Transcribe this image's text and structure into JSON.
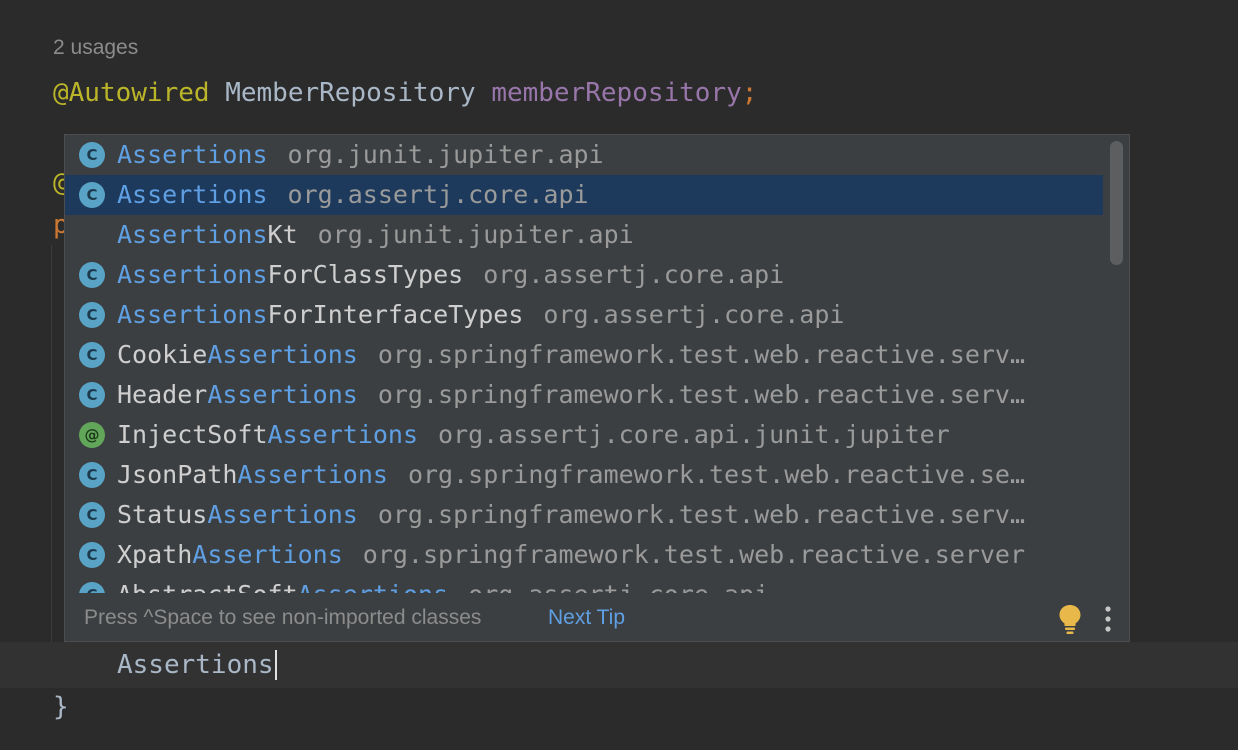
{
  "editor": {
    "usages_label": "2 usages",
    "field_line": {
      "annotation": "@Autowired",
      "type": "MemberRepository",
      "name": "memberRepository",
      "semicolon": ";"
    },
    "partial_line_1": "@",
    "partial_line_2": "p",
    "typed_text": "Assertions",
    "closing_brace": "}"
  },
  "completion": {
    "items": [
      {
        "icon": "class-icon",
        "match": "Assertions",
        "rest": "",
        "package": "org.junit.jupiter.api",
        "selected": false
      },
      {
        "icon": "class-icon",
        "match": "Assertions",
        "rest": "",
        "package": "org.assertj.core.api",
        "selected": true
      },
      {
        "icon": "none",
        "match": "Assertions",
        "rest": "Kt",
        "package": "org.junit.jupiter.api",
        "selected": false
      },
      {
        "icon": "class-icon",
        "match": "Assertions",
        "rest": "ForClassTypes",
        "package": "org.assertj.core.api",
        "selected": false
      },
      {
        "icon": "class-icon",
        "match": "Assertions",
        "rest": "ForInterfaceTypes",
        "package": "org.assertj.core.api",
        "selected": false
      },
      {
        "icon": "class-icon",
        "prefix": "Cookie",
        "match": "Assertions",
        "package": "org.springframework.test.web.reactive.serv…",
        "selected": false
      },
      {
        "icon": "class-icon",
        "prefix": "Header",
        "match": "Assertions",
        "package": "org.springframework.test.web.reactive.serv…",
        "selected": false
      },
      {
        "icon": "annotation-icon",
        "prefix": "InjectSoft",
        "match": "Assertions",
        "package": "org.assertj.core.api.junit.jupiter",
        "selected": false
      },
      {
        "icon": "class-icon",
        "prefix": "JsonPath",
        "match": "Assertions",
        "package": "org.springframework.test.web.reactive.se…",
        "selected": false
      },
      {
        "icon": "class-icon",
        "prefix": "Status",
        "match": "Assertions",
        "package": "org.springframework.test.web.reactive.serv…",
        "selected": false
      },
      {
        "icon": "class-icon",
        "prefix": "Xpath",
        "match": "Assertions",
        "package": "org.springframework.test.web.reactive.server",
        "selected": false
      },
      {
        "icon": "class-icon",
        "prefix": "AbstractSoft",
        "match": "Assertions",
        "package": "org.assertj.core.api",
        "selected": false
      }
    ],
    "footer": {
      "hint": "Press ^Space to see non-imported classes",
      "next_tip": "Next Tip"
    },
    "icons": {
      "class": "C",
      "annotation": "@"
    }
  },
  "colors": {
    "background": "#2b2b2b",
    "popup_bg": "#3c3f41",
    "selection": "#1d3a5c",
    "match": "#5f9fe3",
    "class_icon": "#59a3c7",
    "annotation_icon": "#62a65a",
    "bulb": "#e8b94a"
  }
}
